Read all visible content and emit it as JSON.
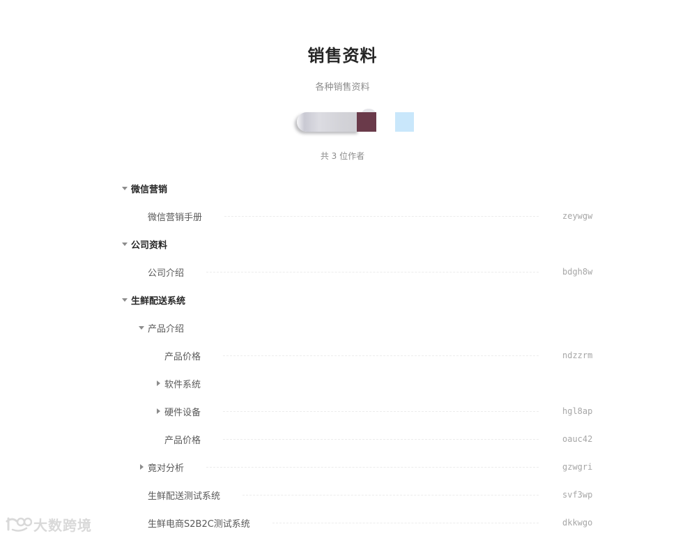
{
  "header": {
    "title": "销售资料",
    "subtitle": "各种销售资料",
    "author_count": "共 3 位作者"
  },
  "avatars": [
    {
      "name": "author-1",
      "color": "#d3d3d8"
    },
    {
      "name": "author-2",
      "color": "#6a3a4a"
    },
    {
      "name": "author-3",
      "color": "#c9e7fb"
    }
  ],
  "toc": [
    {
      "type": "group",
      "label": "微信营销",
      "caret": "down",
      "level": 0,
      "slug": ""
    },
    {
      "type": "doc",
      "label": "微信营销手册",
      "caret": "none",
      "level": 1,
      "slug": "zeywgw"
    },
    {
      "type": "group",
      "label": "公司资料",
      "caret": "down",
      "level": 0,
      "slug": ""
    },
    {
      "type": "doc",
      "label": "公司介绍",
      "caret": "none",
      "level": 1,
      "slug": "bdgh8w"
    },
    {
      "type": "group",
      "label": "生鲜配送系统",
      "caret": "down",
      "level": 0,
      "slug": ""
    },
    {
      "type": "folder",
      "label": "产品介绍",
      "caret": "down",
      "level": 1,
      "slug": ""
    },
    {
      "type": "doc",
      "label": "产品价格",
      "caret": "none",
      "level": 2,
      "slug": "ndzzrm"
    },
    {
      "type": "folder",
      "label": "软件系统",
      "caret": "right",
      "level": 2,
      "slug": ""
    },
    {
      "type": "doc",
      "label": "硬件设备",
      "caret": "right",
      "level": 2,
      "slug": "hgl8ap"
    },
    {
      "type": "doc",
      "label": "产品价格",
      "caret": "none",
      "level": 2,
      "slug": "oauc42"
    },
    {
      "type": "doc",
      "label": "竟对分析",
      "caret": "right",
      "level": 1,
      "slug": "gzwgri"
    },
    {
      "type": "doc",
      "label": "生鲜配送测试系统",
      "caret": "none",
      "level": 1,
      "slug": "svf3wp"
    },
    {
      "type": "doc",
      "label": "生鲜电商S2B2C测试系统",
      "caret": "none",
      "level": 1,
      "slug": "dkkwgo"
    }
  ],
  "watermark": {
    "text": "大数跨境",
    "icon": "brand-logo-icon"
  }
}
